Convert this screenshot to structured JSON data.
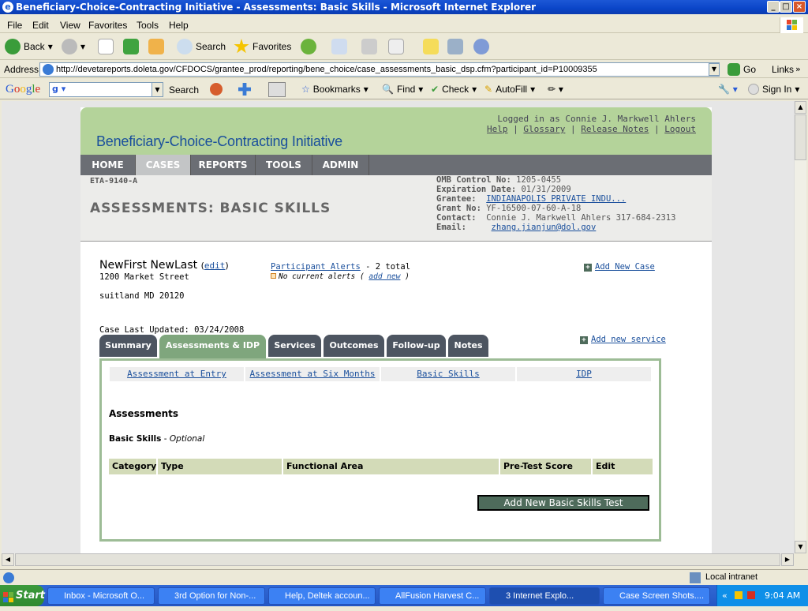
{
  "window": {
    "title": "Beneficiary-Choice-Contracting Initiative - Assessments: Basic Skills - Microsoft Internet Explorer"
  },
  "menu": [
    "File",
    "Edit",
    "View",
    "Favorites",
    "Tools",
    "Help"
  ],
  "toolbar": {
    "back": "Back",
    "search": "Search",
    "favorites": "Favorites"
  },
  "address": {
    "label": "Address",
    "url": "http://devetareports.doleta.gov/CFDOCS/grantee_prod/reporting/bene_choice/case_assessments_basic_dsp.cfm?participant_id=P10009355",
    "go": "Go",
    "links": "Links"
  },
  "googlebar": {
    "search": "Search",
    "bookmarks": "Bookmarks",
    "find": "Find",
    "check": "Check",
    "autofill": "AutoFill",
    "signin": "Sign In"
  },
  "app": {
    "title": "Beneficiary-Choice-Contracting Initiative",
    "logged_in": "Logged in as Connie J. Markwell Ahlers",
    "links": [
      "Help",
      "Glossary",
      "Release Notes",
      "Logout"
    ],
    "nav": [
      "HOME",
      "CASES",
      "REPORTS",
      "TOOLS",
      "ADMIN"
    ],
    "form_code": "ETA-9140-A",
    "page_title": "ASSESSMENTS: BASIC SKILLS",
    "meta": {
      "omb_label": "OMB Control No:",
      "omb": "1205-0455",
      "exp_label": "Expiration Date:",
      "exp": "01/31/2009",
      "grantee_label": "Grantee:",
      "grantee": "INDIANAPOLIS PRIVATE INDU...",
      "grant_label": "Grant No:",
      "grant": "YF-16500-07-60-A-18",
      "contact_label": "Contact:",
      "contact": "Connie J. Markwell Ahlers  317-684-2313",
      "email_label": "Email:",
      "email": "zhang.jianjun@dol.gov"
    }
  },
  "participant": {
    "name": "NewFirst NewLast",
    "edit": "edit",
    "street": "1200 Market Street",
    "city": "suitland MD 20120",
    "alerts_link": "Participant Alerts",
    "alerts_total": " - 2 total",
    "no_alerts": "No current alerts",
    "add_new": "add new",
    "add_new_case": "Add New Case",
    "case_updated": "Case Last Updated: 03/24/2008",
    "add_new_service": "Add new service"
  },
  "tabs": [
    "Summary",
    "Assessments & IDP",
    "Services",
    "Outcomes",
    "Follow-up",
    "Notes"
  ],
  "subtabs": [
    "Assessment at Entry",
    "Assessment at Six Months",
    "Basic Skills",
    "IDP"
  ],
  "section": {
    "heading": "Assessments",
    "sub": "Basic Skills",
    "optional": "Optional",
    "columns": [
      "Category",
      "Type",
      "Functional Area",
      "Pre-Test Score",
      "Edit"
    ],
    "add_button": "Add New Basic Skills Test"
  },
  "status": {
    "zone": "Local intranet"
  },
  "taskbar": {
    "start": "Start",
    "items": [
      "Inbox - Microsoft O...",
      "3rd Option for Non-...",
      "Help, Deltek accoun...",
      "AllFusion Harvest C...",
      "3 Internet Explo...",
      "Case Screen Shots...."
    ],
    "time": "9:04 AM"
  }
}
